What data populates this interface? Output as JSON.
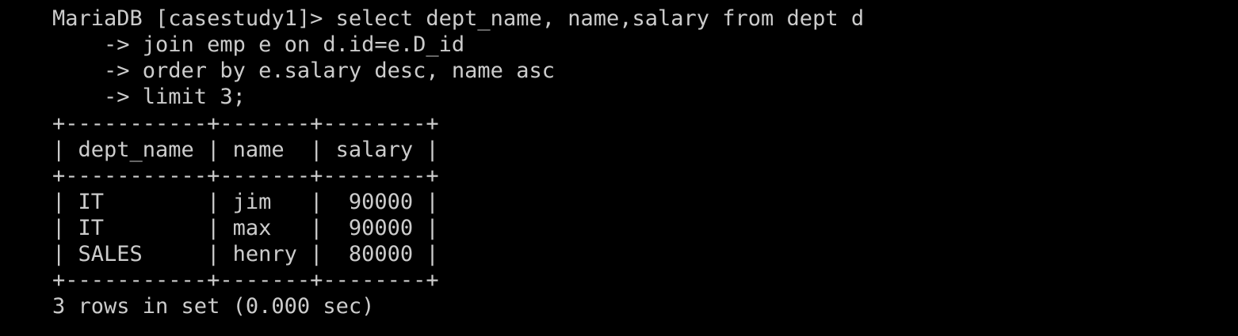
{
  "terminal": {
    "lines": [
      "MariaDB [casestudy1]> select dept_name, name,salary from dept d",
      "    -> join emp e on d.id=e.D_id",
      "    -> order by e.salary desc, name asc",
      "    -> limit 3;",
      "+-----------+-------+--------+",
      "| dept_name | name  | salary |",
      "+-----------+-------+--------+",
      "| IT        | jim   |  90000 |",
      "| IT        | max   |  90000 |",
      "| SALES     | henry |  80000 |",
      "+-----------+-------+--------+",
      "3 rows in set (0.000 sec)"
    ]
  }
}
